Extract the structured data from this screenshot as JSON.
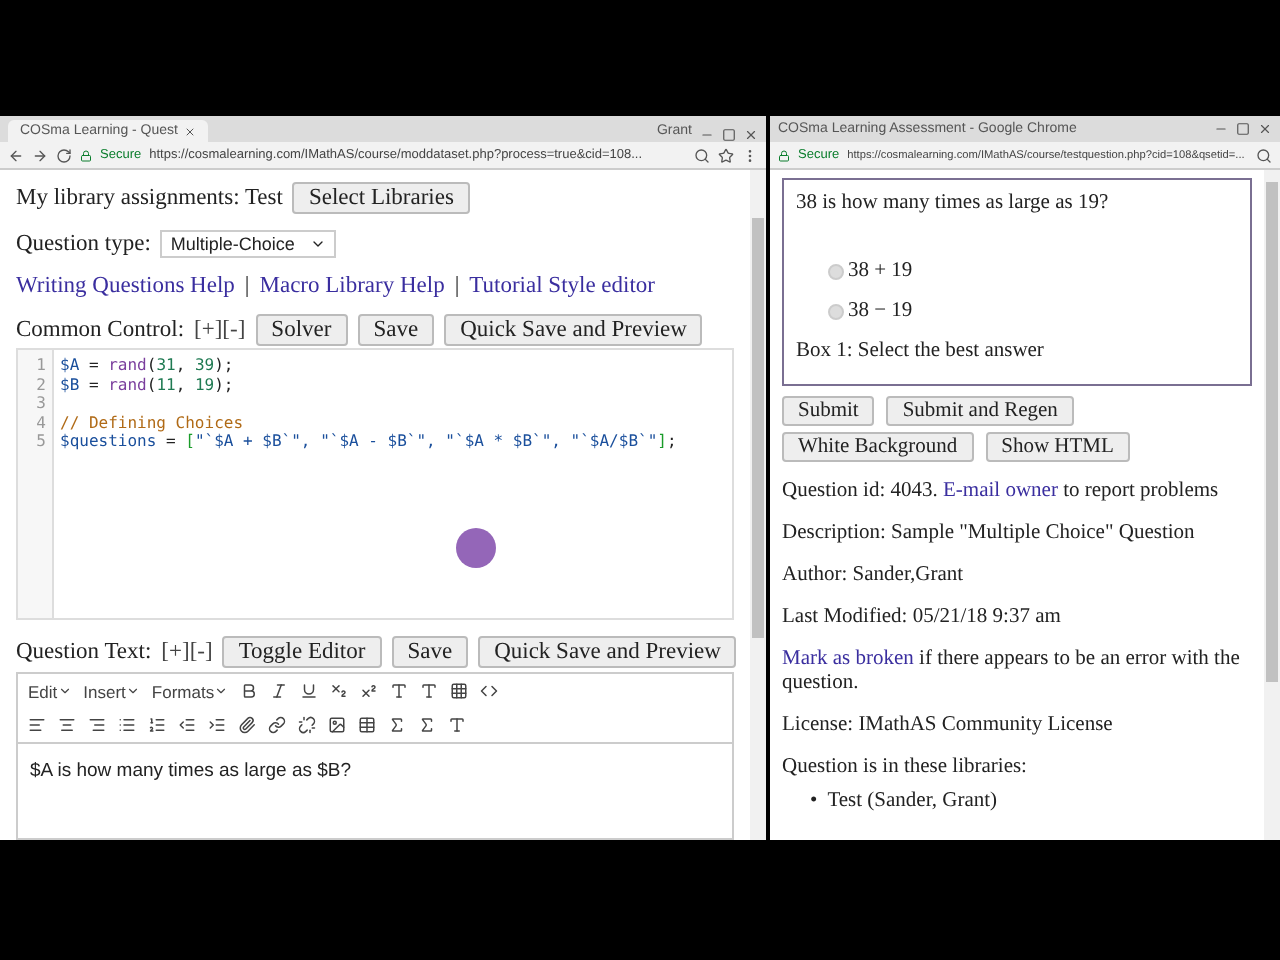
{
  "left_window": {
    "tab_title": "COSma Learning - Quest",
    "user": "Grant",
    "security": "Secure",
    "url": "https://cosmalearning.com/IMathAS/course/moddataset.php?process=true&cid=108...",
    "library": {
      "label": "My library assignments: Test",
      "button": "Select Libraries"
    },
    "question_type": {
      "label": "Question type:",
      "value": "Multiple-Choice"
    },
    "help_links": {
      "separator": "|",
      "links": [
        "Writing Questions Help",
        "Macro Library Help",
        "Tutorial Style editor"
      ]
    },
    "common_control": {
      "label": "Common Control:",
      "toggles": "[+][-]",
      "buttons": [
        "Solver",
        "Save",
        "Quick Save and Preview"
      ]
    },
    "code_lines": [
      {
        "number": "1",
        "tokens": [
          {
            "kind": "var",
            "text": "$A"
          },
          {
            "kind": "plain",
            "text": " = "
          },
          {
            "kind": "fn",
            "text": "rand"
          },
          {
            "kind": "plain",
            "text": "("
          },
          {
            "kind": "num",
            "text": "31"
          },
          {
            "kind": "plain",
            "text": ", "
          },
          {
            "kind": "num",
            "text": "39"
          },
          {
            "kind": "plain",
            "text": ");"
          }
        ]
      },
      {
        "number": "2",
        "tokens": [
          {
            "kind": "var",
            "text": "$B"
          },
          {
            "kind": "plain",
            "text": " = "
          },
          {
            "kind": "fn",
            "text": "rand"
          },
          {
            "kind": "plain",
            "text": "("
          },
          {
            "kind": "num",
            "text": "11"
          },
          {
            "kind": "plain",
            "text": ", "
          },
          {
            "kind": "num",
            "text": "19"
          },
          {
            "kind": "plain",
            "text": ");"
          }
        ]
      },
      {
        "number": "3"
      },
      {
        "number": "4",
        "tokens": [
          {
            "kind": "comment",
            "text": "// Defining Choices"
          }
        ]
      },
      {
        "number": "5",
        "tokens": [
          {
            "kind": "var",
            "text": "$questions"
          },
          {
            "kind": "plain",
            "text": " = "
          },
          {
            "kind": "bracket",
            "text": "["
          },
          {
            "kind": "var",
            "text": "\"`$A + $B`\", \"`$A - $B`\", \"`$A * $B`\", \"`$A/$B`\""
          },
          {
            "kind": "bracket",
            "text": "]"
          },
          {
            "kind": "plain",
            "text": ";"
          }
        ]
      }
    ],
    "question_text": {
      "label": "Question Text:",
      "toggles": "[+][-]",
      "buttons": [
        "Toggle Editor",
        "Save",
        "Quick Save and Preview"
      ]
    },
    "editor": {
      "menus": [
        "Edit",
        "Insert",
        "Formats"
      ],
      "content": "$A is how many times as large as $B?"
    }
  },
  "right_window": {
    "title": "COSma Learning Assessment - Google Chrome",
    "security": "Secure",
    "url": "https://cosmalearning.com/IMathAS/course/testquestion.php?cid=108&qsetid=...",
    "question": "38 is how many times as large as 19?",
    "choices": [
      {
        "label": "38 + 19",
        "selected": false
      },
      {
        "label": "38 − 19",
        "selected": false
      }
    ],
    "box_note": "Box 1: Select the best answer",
    "buttons": [
      "Submit",
      "Submit and Regen",
      "White Background",
      "Show HTML"
    ],
    "info": [
      [
        {
          "kind": "text",
          "text": "Question id: 4043. "
        },
        {
          "kind": "link",
          "text": "E-mail owner"
        },
        {
          "kind": "text",
          "text": " to report problems"
        }
      ],
      [
        {
          "kind": "text",
          "text": "Description: Sample \"Multiple Choice\" Question"
        }
      ],
      [
        {
          "kind": "text",
          "text": "Author: Sander,Grant"
        }
      ],
      [
        {
          "kind": "text",
          "text": "Last Modified: 05/21/18 9:37 am"
        }
      ],
      [
        {
          "kind": "link",
          "text": "Mark as broken"
        },
        {
          "kind": "text",
          "text": " if there appears to be an error with the question."
        }
      ],
      [
        {
          "kind": "text",
          "text": "License: IMathAS Community License"
        }
      ],
      [
        {
          "kind": "text",
          "text": "Question is in these libraries:"
        }
      ]
    ],
    "libraries": [
      {
        "marker": "•",
        "name": "Test (Sander, Grant)"
      }
    ]
  }
}
